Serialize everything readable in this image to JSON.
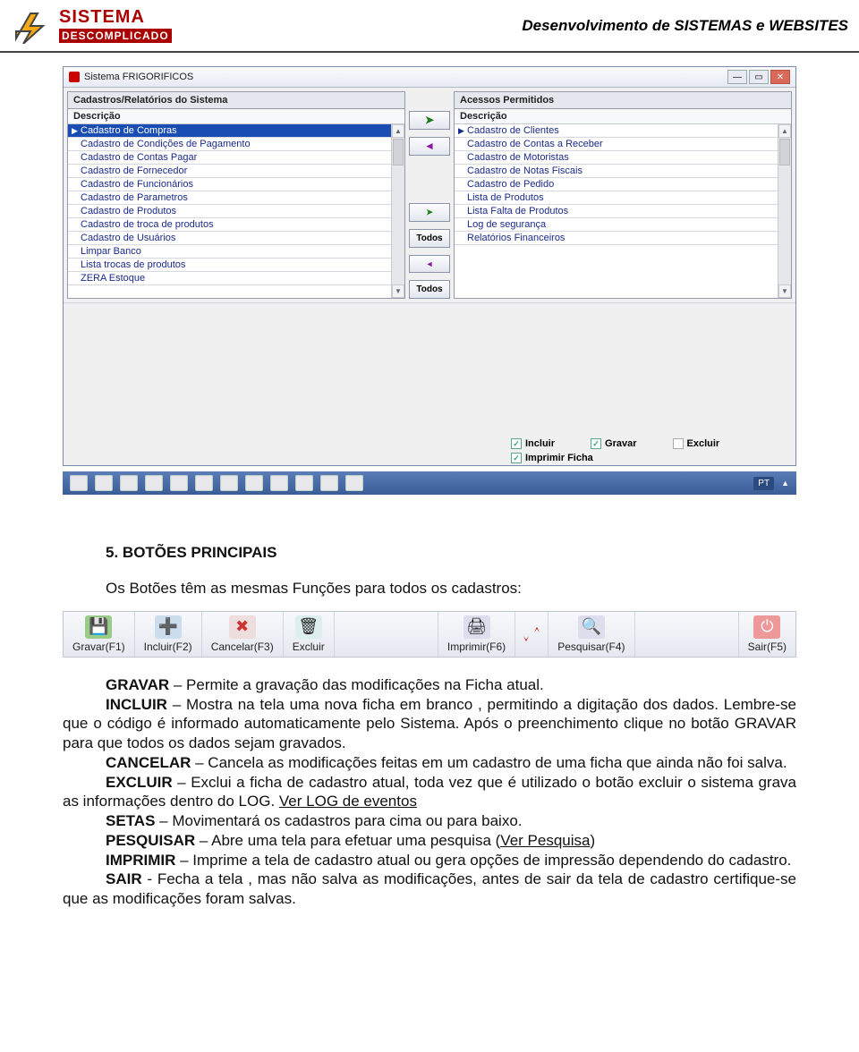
{
  "header": {
    "logo_line1": "SISTEMA",
    "logo_line2": "DESCOMPLICADO",
    "title": "Desenvolvimento de SISTEMAS e WEBSITES"
  },
  "window": {
    "title": "Sistema FRIGORIFICOS",
    "left_panel_title": "Cadastros/Relatórios do Sistema",
    "right_panel_title": "Acessos Permitidos",
    "col_header": "Descrição",
    "left_items": [
      "Cadastro de Compras",
      "Cadastro de Condições de Pagamento",
      "Cadastro de Contas Pagar",
      "Cadastro de Fornecedor",
      "Cadastro de Funcionários",
      "Cadastro de Parametros",
      "Cadastro de Produtos",
      "Cadastro de troca de produtos",
      "Cadastro de Usuários",
      "Limpar Banco",
      "Lista trocas de produtos",
      "ZERA Estoque"
    ],
    "right_items": [
      "Cadastro de Clientes",
      "Cadastro de Contas a Receber",
      "Cadastro de Motoristas",
      "Cadastro de Notas Fiscais",
      "Cadastro de Pedido",
      "Lista de Produtos",
      "Lista Falta de Produtos",
      "Log de segurança",
      "Relatórios Financeiros"
    ],
    "btn_add": "➤",
    "btn_remove": "◄",
    "btn_todos": "Todos",
    "checks": {
      "incluir": "Incluir",
      "gravar": "Gravar",
      "excluir": "Excluir",
      "imprimir": "Imprimir Ficha"
    },
    "taskbar_lang": "PT"
  },
  "doc": {
    "section_no": "5.",
    "section_title": "BOTÕES PRINCIPAIS",
    "intro": "Os Botões têm as mesmas Funções para todos os cadastros:",
    "btnbar": [
      "Gravar(F1)",
      "Incluir(F2)",
      "Cancelar(F3)",
      "Excluir",
      "Imprimir(F6)",
      "Pesquisar(F4)",
      "Sair(F5)"
    ],
    "p_gravar_b": "GRAVAR",
    "p_gravar": " – Permite a gravação das modificações na Ficha atual.",
    "p_incluir_b": "INCLUIR",
    "p_incluir": " – Mostra na tela uma nova ficha em branco , permitindo a digitação dos dados. Lembre-se que o código é informado automaticamente pelo Sistema. Após o preenchimento clique no botão GRAVAR para que todos os dados sejam gravados.",
    "p_cancelar_b": "CANCELAR",
    "p_cancelar": " – Cancela as modificações feitas em um cadastro de uma ficha que ainda não foi salva.",
    "p_excluir_b": "EXCLUIR",
    "p_excluir_1": " – Exclui a ficha de cadastro atual, toda vez que é utilizado o botão excluir o sistema grava as informações dentro do LOG. ",
    "p_excluir_link": "Ver LOG de eventos",
    "p_setas_b": "SETAS",
    "p_setas": " – Movimentará os cadastros para cima ou para baixo.",
    "p_pesquisar_b": "PESQUISAR",
    "p_pesquisar_1": " – Abre uma tela para efetuar uma pesquisa (",
    "p_pesquisar_link": "Ver Pesquisa",
    "p_pesquisar_2": ")",
    "p_imprimir_b": "IMPRIMIR",
    "p_imprimir": " – Imprime a tela de cadastro atual ou gera opções de impressão dependendo do cadastro.",
    "p_sair_b": "SAIR",
    "p_sair": " - Fecha a tela , mas não salva as modificações, antes de sair da tela de cadastro certifique-se que as modificações foram salvas."
  }
}
